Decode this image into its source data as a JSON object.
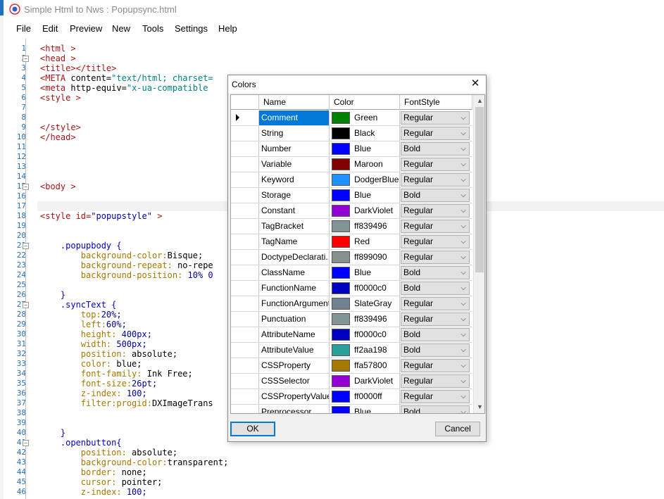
{
  "window": {
    "title": "Simple Html to Nws : Popupsync.html"
  },
  "menu": [
    "File",
    "Edit",
    "Preview",
    "New",
    "Tools",
    "Settings",
    "Help"
  ],
  "editor": {
    "line_numbers": [
      "1",
      "2",
      "3",
      "4",
      "5",
      "6",
      "7",
      "8",
      "9",
      "10",
      "11",
      "12",
      "13",
      "14",
      "15",
      "16",
      "17",
      "18",
      "19",
      "20",
      "21",
      "22",
      "23",
      "24",
      "25",
      "26",
      "27",
      "28",
      "29",
      "30",
      "31",
      "32",
      "33",
      "34",
      "35",
      "36",
      "37",
      "38",
      "39",
      "40",
      "41",
      "42",
      "43",
      "44",
      "45",
      "46"
    ],
    "lines": [
      [
        [
          "<html >",
          "#a31515"
        ]
      ],
      [
        [
          "<head >",
          "#a31515"
        ]
      ],
      [
        [
          "<title></title>",
          "#a31515"
        ]
      ],
      [
        [
          "<META ",
          "#a31515"
        ],
        [
          "content=",
          "#000000"
        ],
        [
          "\"text/html; charset=",
          "#008080"
        ]
      ],
      [
        [
          "<meta ",
          "#a31515"
        ],
        [
          "http-equiv=",
          "#000000"
        ],
        [
          "\"x-ua-compatible",
          "#008080"
        ]
      ],
      [
        [
          "<style >",
          "#a31515"
        ]
      ],
      [],
      [],
      [
        [
          "</style>",
          "#a31515"
        ]
      ],
      [
        [
          "</head>",
          "#a31515"
        ]
      ],
      [],
      [],
      [],
      [],
      [
        [
          "<body >",
          "#a31515"
        ]
      ],
      [],
      [],
      [
        [
          "<style ",
          "#a31515"
        ],
        [
          "id=",
          "#a31515"
        ],
        [
          "\"popupstyle\"",
          "#0000a0"
        ],
        [
          " >",
          "#a31515"
        ]
      ],
      [],
      [],
      [
        [
          "    .popupbody {",
          "#0000c0"
        ]
      ],
      [
        [
          "        background-color:",
          "#a57800"
        ],
        [
          "Bisque;",
          "#000000"
        ]
      ],
      [
        [
          "        background-repeat: ",
          "#a57800"
        ],
        [
          "no-repe",
          "#000000"
        ]
      ],
      [
        [
          "        background-position: ",
          "#a57800"
        ],
        [
          "10% 0",
          "#0000a0"
        ]
      ],
      [],
      [
        [
          "    }",
          "#0000c0"
        ]
      ],
      [
        [
          "    .syncText {",
          "#0000c0"
        ]
      ],
      [
        [
          "        top:",
          "#a57800"
        ],
        [
          "20%;",
          "#0000a0"
        ]
      ],
      [
        [
          "        left:",
          "#a57800"
        ],
        [
          "60%;",
          "#0000a0"
        ]
      ],
      [
        [
          "        height: ",
          "#a57800"
        ],
        [
          "400px;",
          "#0000a0"
        ]
      ],
      [
        [
          "        width: ",
          "#a57800"
        ],
        [
          "500px;",
          "#0000a0"
        ]
      ],
      [
        [
          "        position: ",
          "#a57800"
        ],
        [
          "absolute;",
          "#000000"
        ]
      ],
      [
        [
          "        color: ",
          "#a57800"
        ],
        [
          "blue;",
          "#000000"
        ]
      ],
      [
        [
          "        font-family: ",
          "#a57800"
        ],
        [
          "Ink Free;",
          "#000000"
        ]
      ],
      [
        [
          "        font-size:",
          "#a57800"
        ],
        [
          "26pt;",
          "#0000a0"
        ]
      ],
      [
        [
          "        z-index: ",
          "#a57800"
        ],
        [
          "100;",
          "#0000a0"
        ]
      ],
      [
        [
          "        filter:progid:",
          "#a57800"
        ],
        [
          "DXImageTrans",
          "#000000"
        ]
      ],
      [],
      [],
      [
        [
          "    }",
          "#0000c0"
        ]
      ],
      [
        [
          "    .openbutton{",
          "#0000c0"
        ]
      ],
      [
        [
          "        position: ",
          "#a57800"
        ],
        [
          "absolute;",
          "#000000"
        ]
      ],
      [
        [
          "        background-color:",
          "#a57800"
        ],
        [
          "transparent;",
          "#000000"
        ]
      ],
      [
        [
          "        border: ",
          "#a57800"
        ],
        [
          "none;",
          "#000000"
        ]
      ],
      [
        [
          "        cursor: ",
          "#a57800"
        ],
        [
          "pointer;",
          "#000000"
        ]
      ],
      [
        [
          "        z-index: ",
          "#a57800"
        ],
        [
          "100;",
          "#0000a0"
        ]
      ]
    ],
    "fold_lines": [
      2,
      15,
      21,
      27,
      41
    ]
  },
  "dialog": {
    "title": "Colors",
    "columns": [
      "Name",
      "Color",
      "FontStyle"
    ],
    "rows": [
      {
        "name": "Comment",
        "color": "Green",
        "hex": "#008000",
        "style": "Regular"
      },
      {
        "name": "String",
        "color": "Black",
        "hex": "#000000",
        "style": "Regular"
      },
      {
        "name": "Number",
        "color": "Blue",
        "hex": "#0000ff",
        "style": "Bold"
      },
      {
        "name": "Variable",
        "color": "Maroon",
        "hex": "#800000",
        "style": "Regular"
      },
      {
        "name": "Keyword",
        "color": "DodgerBlue",
        "hex": "#1e90ff",
        "style": "Regular"
      },
      {
        "name": "Storage",
        "color": "Blue",
        "hex": "#0000ff",
        "style": "Bold"
      },
      {
        "name": "Constant",
        "color": "DarkViolet",
        "hex": "#9400d3",
        "style": "Regular"
      },
      {
        "name": "TagBracket",
        "color": "ff839496",
        "hex": "#839496",
        "style": "Regular"
      },
      {
        "name": "TagName",
        "color": "Red",
        "hex": "#ff0000",
        "style": "Regular"
      },
      {
        "name": "DoctypeDeclarati...",
        "color": "ff899090",
        "hex": "#899090",
        "style": "Regular"
      },
      {
        "name": "ClassName",
        "color": "Blue",
        "hex": "#0000ff",
        "style": "Bold"
      },
      {
        "name": "FunctionName",
        "color": "ff0000c0",
        "hex": "#0000c0",
        "style": "Bold"
      },
      {
        "name": "FunctionArgument",
        "color": "SlateGray",
        "hex": "#708090",
        "style": "Regular"
      },
      {
        "name": "Punctuation",
        "color": "ff839496",
        "hex": "#839496",
        "style": "Regular"
      },
      {
        "name": "AttributeName",
        "color": "ff0000c0",
        "hex": "#0000c0",
        "style": "Bold"
      },
      {
        "name": "AttributeValue",
        "color": "ff2aa198",
        "hex": "#2aa198",
        "style": "Bold"
      },
      {
        "name": "CSSProperty",
        "color": "ffa57800",
        "hex": "#a57800",
        "style": "Regular"
      },
      {
        "name": "CSSSelector",
        "color": "DarkViolet",
        "hex": "#9400d3",
        "style": "Regular"
      },
      {
        "name": "CSSPropertyValue",
        "color": "ff0000ff",
        "hex": "#0000ff",
        "style": "Regular"
      },
      {
        "name": "Preprocessor",
        "color": "Blue",
        "hex": "#0000ff",
        "style": "Bold"
      }
    ],
    "ok_label": "OK",
    "cancel_label": "Cancel"
  }
}
